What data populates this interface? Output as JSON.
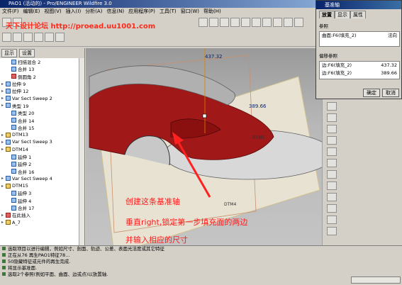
{
  "window": {
    "title": "PAO1 (活动的) - Pro/ENGINEER Wildfire 3.0"
  },
  "menu": [
    "文件(F)",
    "编辑(E)",
    "视图(V)",
    "插入(I)",
    "分析(A)",
    "信息(N)",
    "应用程序(P)",
    "工具(T)",
    "窗口(W)",
    "帮助(H)"
  ],
  "watermark": "天下设计论坛 http://proead.uu1001.com",
  "left_panel": {
    "tabs": [
      "显示",
      "设置"
    ],
    "tree": [
      {
        "label": "扫描混合 2",
        "icon": "blue",
        "indent": 1
      },
      {
        "label": "合并 13",
        "icon": "blue",
        "indent": 1
      },
      {
        "label": "倒圆角 2",
        "icon": "red",
        "indent": 1
      },
      {
        "label": "拉伸 9",
        "icon": "blue",
        "indent": 0
      },
      {
        "label": "拉伸 12",
        "icon": "blue",
        "indent": 0
      },
      {
        "label": "Var Sect Sweep 2",
        "icon": "blue",
        "indent": 0
      },
      {
        "label": "类型 19",
        "icon": "blue",
        "indent": 0
      },
      {
        "label": "类型 20",
        "icon": "blue",
        "indent": 1
      },
      {
        "label": "合并 14",
        "icon": "blue",
        "indent": 1
      },
      {
        "label": "合并 15",
        "icon": "blue",
        "indent": 1
      },
      {
        "label": "DTM13",
        "icon": "yellow",
        "indent": 0
      },
      {
        "label": "Var Sect Sweep 3",
        "icon": "blue",
        "indent": 0
      },
      {
        "label": "DTM14",
        "icon": "yellow",
        "indent": 0
      },
      {
        "label": "延伸 1",
        "icon": "blue",
        "indent": 1
      },
      {
        "label": "延伸 2",
        "icon": "blue",
        "indent": 1
      },
      {
        "label": "合并 16",
        "icon": "blue",
        "indent": 1
      },
      {
        "label": "Var Sect Sweep 4",
        "icon": "blue",
        "indent": 0
      },
      {
        "label": "DTM15",
        "icon": "yellow",
        "indent": 0
      },
      {
        "label": "延伸 3",
        "icon": "blue",
        "indent": 1
      },
      {
        "label": "延伸 4",
        "icon": "blue",
        "indent": 1
      },
      {
        "label": "合并 17",
        "icon": "blue",
        "indent": 1
      },
      {
        "label": "在此插入",
        "icon": "red",
        "indent": 0
      },
      {
        "label": "A_7",
        "icon": "yellow",
        "indent": 0
      }
    ]
  },
  "annotations": {
    "line1": "创建这条基准轴",
    "line2": "垂直right,锁定第一步填充面的两边",
    "line3": "并输入相应的尺寸"
  },
  "viewport_labels": {
    "dim1": "437.32",
    "dim2": "389.66",
    "dtm_a": "DTM4",
    "dtm_b": "DTM5"
  },
  "dialog": {
    "title": "基准轴",
    "tabs": [
      "放置",
      "显示",
      "属性"
    ],
    "ref_group": "参照",
    "ref_row": {
      "name": "曲面:F6(填充_2)",
      "value": "法向"
    },
    "offset_group": "偏移参照",
    "offset_rows": [
      {
        "name": "边:F6(填充_2)",
        "value": "437.32"
      },
      {
        "name": "边:F6(填充_2)",
        "value": "389.66"
      }
    ],
    "ok": "确定",
    "cancel": "取消"
  },
  "messages": [
    "选取项目以进行编辑，例如尺寸、剖面、轨迹、公差、表面光洁度或其它特征",
    "正在从76 再生PAO1特征78...",
    "50隐藏特征或元件的再生完成.",
    "将显示基准面.",
    "选取2个参照(例如平面、曲面、边或点)以放置轴."
  ],
  "colors": {
    "accent": "#0a246a",
    "annotation": "#ff1a1a",
    "model": "#a01818"
  }
}
